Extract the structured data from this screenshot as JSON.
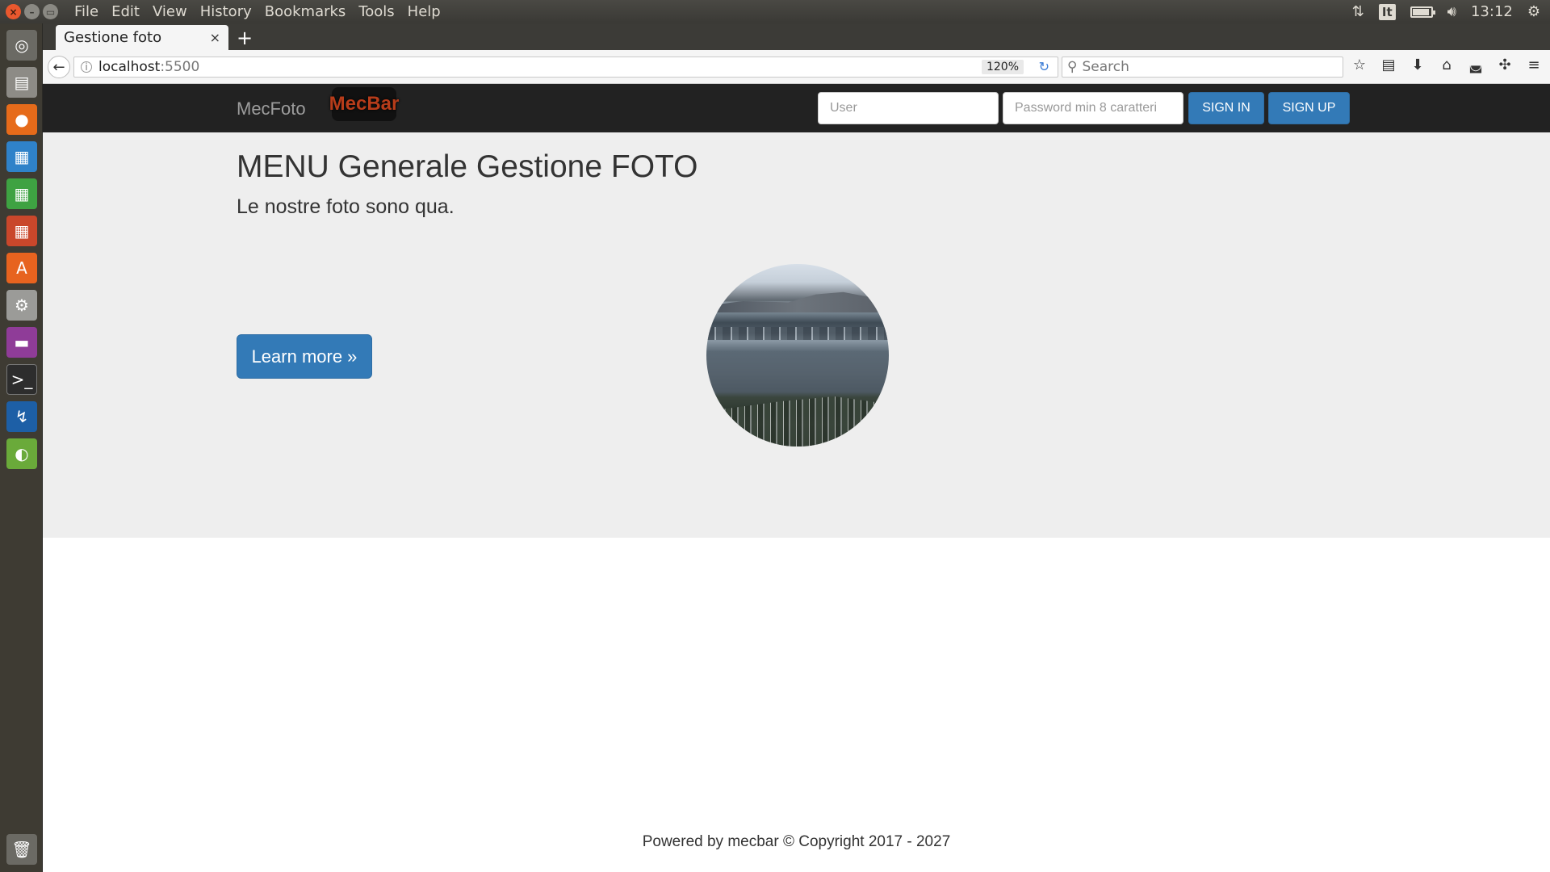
{
  "system": {
    "menu": [
      "File",
      "Edit",
      "View",
      "History",
      "Bookmarks",
      "Tools",
      "Help"
    ],
    "tray": {
      "keyboard_layout": "It",
      "clock": "13:12",
      "battery_level": 0.85
    },
    "launcher_icons": [
      "ubuntu-dash-icon",
      "files-icon",
      "firefox-icon",
      "writer-icon",
      "calc-icon",
      "impress-icon",
      "software-center-icon",
      "settings-icon",
      "video-icon",
      "terminal-icon",
      "network-icon",
      "app-icon",
      "trash-icon"
    ]
  },
  "browser": {
    "tab_title": "Gestione foto",
    "tab_close": "×",
    "new_tab": "+",
    "url_host": "localhost",
    "url_port": ":5500",
    "zoom": "120%",
    "search_placeholder": "Search"
  },
  "site": {
    "brand": "MecFoto",
    "logo_text": "MecBar",
    "user_placeholder": "User",
    "password_placeholder": "Password min 8 caratteri",
    "signin_label": "SIGN IN",
    "signup_label": "SIGN UP",
    "title": "MENU Generale Gestione FOTO",
    "subtitle": "Le nostre foto sono qua.",
    "learn_more": "Learn more »",
    "footer": "Powered by mecbar © Copyright 2017 - 2027"
  },
  "colors": {
    "navbar_bg": "#222222",
    "primary": "#337ab7",
    "jumbotron_bg": "#eeeeee"
  }
}
